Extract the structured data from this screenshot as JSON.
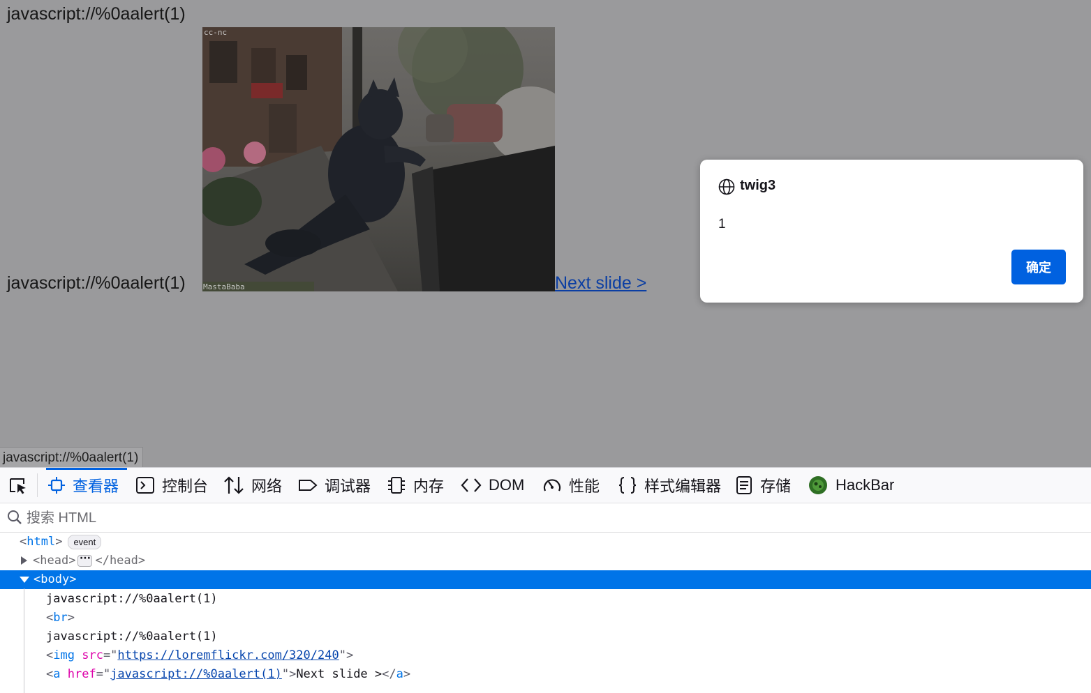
{
  "page": {
    "line1": "javascript://%0aalert(1)",
    "line2": "javascript://%0aalert(1)",
    "link_text": "Next slide >",
    "image_alt": "cat statue on street",
    "watermark_top": "cc-nc",
    "watermark_bottom": "MastaBaba",
    "status_text": "javascript://%0aalert(1)"
  },
  "dialog": {
    "origin": "twig3",
    "message": "1",
    "ok_label": "确定"
  },
  "devtools": {
    "tabs": [
      {
        "label": "查看器",
        "icon": "inspector-icon",
        "active": true
      },
      {
        "label": "控制台",
        "icon": "console-icon"
      },
      {
        "label": "网络",
        "icon": "network-icon"
      },
      {
        "label": "调试器",
        "icon": "debugger-icon"
      },
      {
        "label": "内存",
        "icon": "memory-icon"
      },
      {
        "label": "DOM",
        "icon": "dom-icon"
      },
      {
        "label": "性能",
        "icon": "performance-icon"
      },
      {
        "label": "样式编辑器",
        "icon": "style-editor-icon"
      },
      {
        "label": "存储",
        "icon": "storage-icon"
      },
      {
        "label": "HackBar",
        "icon": "hackbar-icon"
      }
    ],
    "search_placeholder": "搜索 HTML",
    "tree": {
      "html_tag": "html",
      "event_badge": "event",
      "head_tag": "head",
      "body_tag": "body",
      "text1": "javascript://%0aalert(1)",
      "br_tag": "br",
      "text2": "javascript://%0aalert(1)",
      "img_tag": "img",
      "img_attr": "src",
      "img_src": "https://loremflickr.com/320/240",
      "a_tag": "a",
      "a_attr": "href",
      "a_href": "javascript://%0aalert(1)",
      "a_text": "Next slide >"
    }
  },
  "colors": {
    "overlay": "#9a9a9c",
    "accent": "#0061e0",
    "selection": "#0074e8"
  }
}
